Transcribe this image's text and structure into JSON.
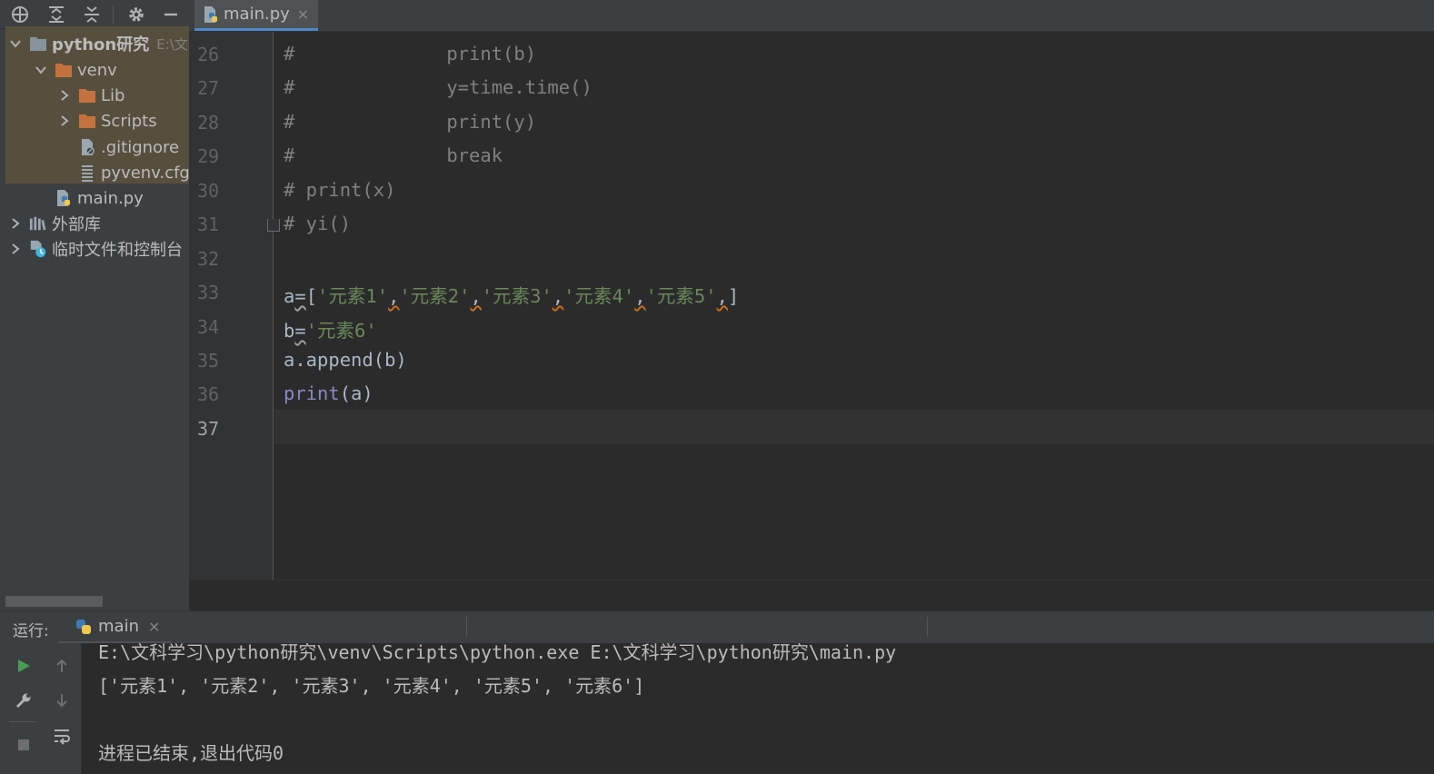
{
  "sidebar": {
    "toolbar": [
      "locate-icon",
      "expand-all-icon",
      "collapse-all-icon",
      "gear-icon",
      "minimize-icon"
    ],
    "tree": [
      {
        "label": "python研究",
        "hint": "E:\\文",
        "icon": "folder-icon",
        "expanded": true
      },
      {
        "label": "venv",
        "icon": "folder-icon",
        "expanded": true
      },
      {
        "label": "Lib",
        "icon": "folder-icon",
        "expanded": false
      },
      {
        "label": "Scripts",
        "icon": "folder-icon",
        "expanded": false
      },
      {
        "label": ".gitignore",
        "icon": "file-icon"
      },
      {
        "label": "pyvenv.cfg",
        "icon": "config-file-icon"
      },
      {
        "label": "main.py",
        "icon": "python-file-icon"
      },
      {
        "label": "外部库",
        "icon": "library-icon",
        "expanded": false
      },
      {
        "label": "临时文件和控制台",
        "icon": "scratch-icon",
        "expanded": false
      }
    ]
  },
  "editor": {
    "tab_label": "main.py",
    "tab_close": "×",
    "line_numbers": [
      "26",
      "27",
      "28",
      "29",
      "30",
      "31",
      "32",
      "33",
      "34",
      "35",
      "36",
      "37"
    ],
    "code": {
      "l26_hash": "#",
      "l26_body": "print(b)",
      "l27_hash": "#",
      "l27_body": "y=time.time()",
      "l28_hash": "#",
      "l28_body": "print(y)",
      "l29_hash": "#",
      "l29_body": "break",
      "l30": "# print(x)",
      "l31": "# yi()",
      "l33_a": "a",
      "l33_eq": "=",
      "l33_open": "[",
      "l33_s1": "'元素1'",
      "l33_s2": "'元素2'",
      "l33_s3": "'元素3'",
      "l33_s4": "'元素4'",
      "l33_s5": "'元素5'",
      "l33_comma": ",",
      "l33_close": "]",
      "l34_b": "b",
      "l34_eq": "=",
      "l34_s": "'元素6'",
      "l35": "a.append(b)",
      "l36_fn": "print",
      "l36_args": "(a)"
    }
  },
  "run": {
    "label": "运行:",
    "tab_label": "main",
    "tab_close": "×",
    "console": [
      "E:\\文科学习\\python研究\\venv\\Scripts\\python.exe E:\\文科学习\\python研究\\main.py",
      "['元素1', '元素2', '元素3', '元素4', '元素5', '元素6']",
      "",
      "进程已结束,退出代码0"
    ]
  },
  "colors": {
    "folder": "#c4723d",
    "accent": "#4a88c7",
    "play": "#499c54",
    "string": "#6a8759",
    "builtin": "#8888c6",
    "comment": "#808080"
  }
}
